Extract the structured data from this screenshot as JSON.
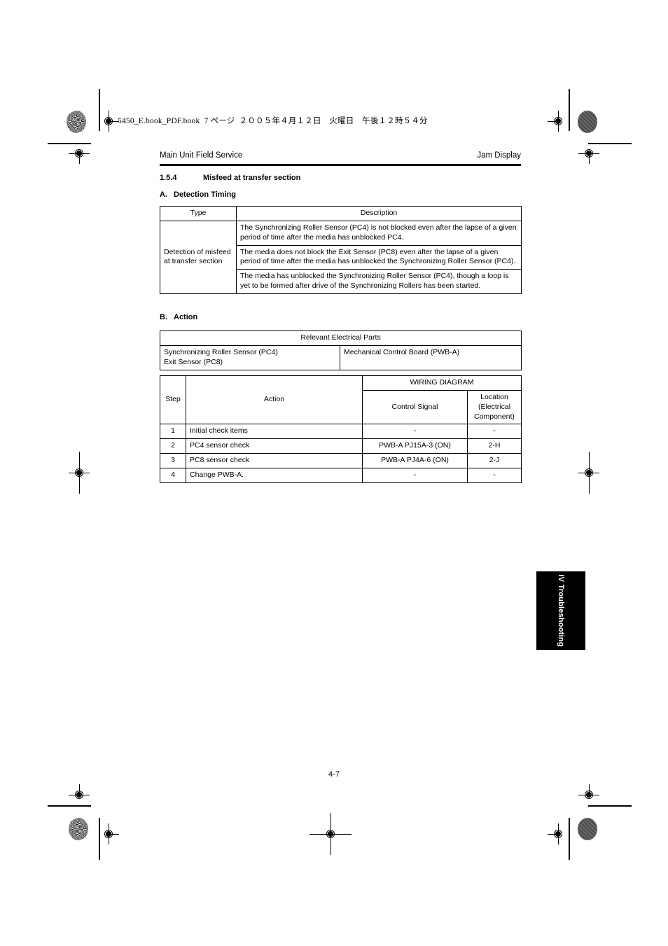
{
  "print_marks": {
    "file_stamp": "5450_E.book_PDF.book  7 ページ  ２００５年４月１２日　火曜日　午後１２時５４分"
  },
  "header": {
    "left": "Main Unit Field Service",
    "right": "Jam Display"
  },
  "section": {
    "number": "1.5.4",
    "title": "Misfeed at transfer section"
  },
  "subsections": {
    "a": {
      "letter": "A.",
      "title": "Detection Timing"
    },
    "b": {
      "letter": "B.",
      "title": "Action"
    }
  },
  "detection_table": {
    "headers": [
      "Type",
      "Description"
    ],
    "type_label": "Detection of misfeed at transfer section",
    "descriptions": [
      "The Synchronizing Roller Sensor (PC4) is not blocked even after the lapse of a given period of time after the media has unblocked PC4.",
      "The media does not block the Exit Sensor (PC8) even after the lapse of a given period of time after the media has unblocked the Synchronizing Roller Sensor (PC4).",
      "The media has unblocked the Synchronizing Roller Sensor (PC4), though a loop is yet to be formed after drive of the Synchronizing Rollers has been started."
    ]
  },
  "parts_table": {
    "header": "Relevant Electrical Parts",
    "left": "Synchronizing Roller Sensor (PC4)\nExit Sensor (PC8)",
    "left_line1": "Synchronizing Roller Sensor (PC4)",
    "left_line2": "Exit Sensor (PC8)",
    "right": "Mechanical Control Board (PWB-A)"
  },
  "action_table": {
    "headers": {
      "step": "Step",
      "action": "Action",
      "wiring_diagram": "WIRING DIAGRAM",
      "control_signal": "Control Signal",
      "location": "Location (Electrical Component)",
      "location_line1": "Location",
      "location_line2": "(Electrical",
      "location_line3": "Component)"
    },
    "rows": [
      {
        "step": "1",
        "action": "Initial check items",
        "control_signal": "-",
        "location": "-"
      },
      {
        "step": "2",
        "action": "PC4 sensor check",
        "control_signal": "PWB-A PJ15A-3 (ON)",
        "location": "2-H"
      },
      {
        "step": "3",
        "action": "PC8 sensor check",
        "control_signal": "PWB-A PJ4A-6 (ON)",
        "location": "2-J"
      },
      {
        "step": "4",
        "action": "Change PWB-A.",
        "control_signal": "-",
        "location": "-"
      }
    ]
  },
  "thumb_tab": {
    "label": "IV Troubleshooting"
  },
  "folio": {
    "page_number": "4-7"
  }
}
